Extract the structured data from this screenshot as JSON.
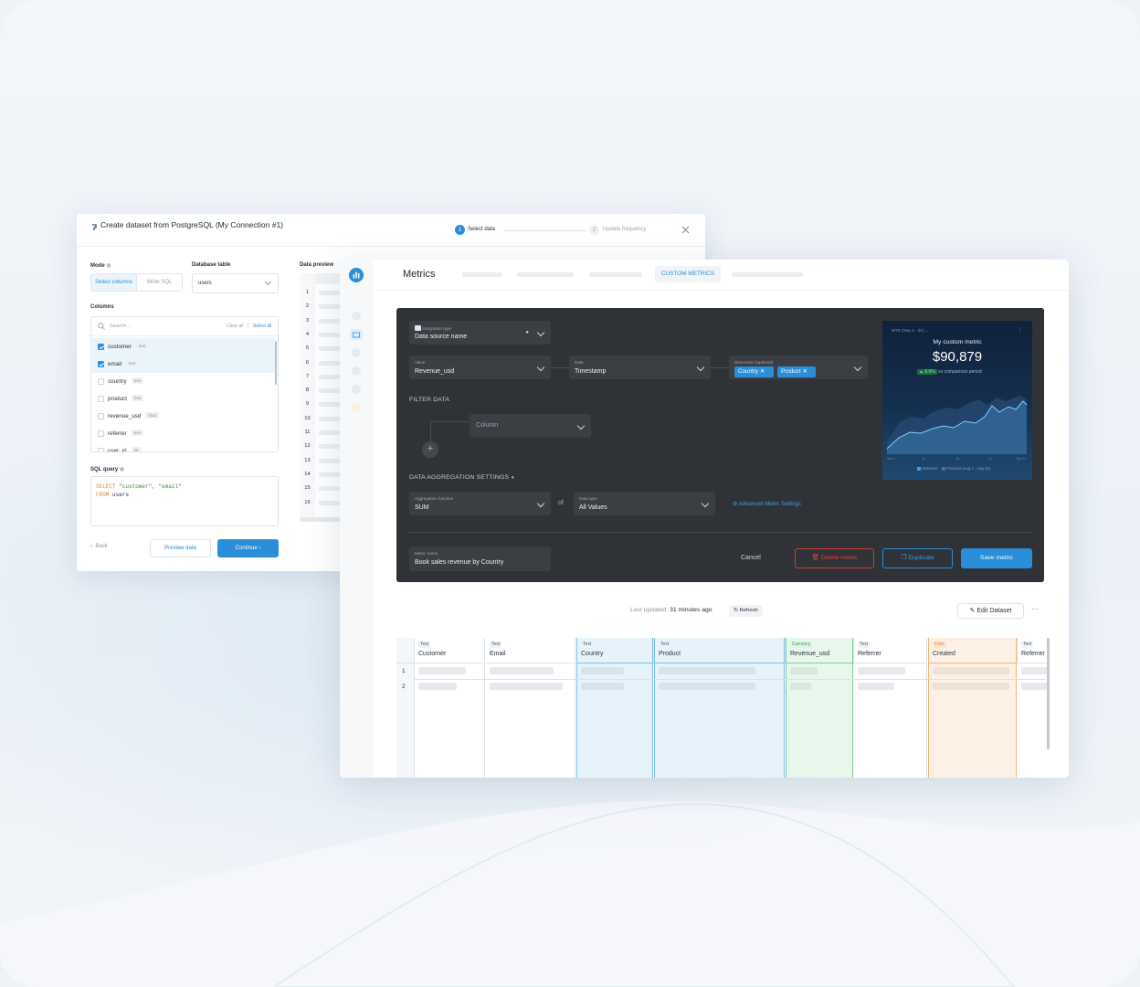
{
  "dataset_dialog": {
    "title": "Create dataset from PostgreSQL (My Connection #1)",
    "steps": [
      {
        "num": "1",
        "label": "Select data"
      },
      {
        "num": "2",
        "label": "Update frequency"
      }
    ],
    "mode": {
      "label": "Mode",
      "options": [
        "Select columns",
        "Write SQL"
      ]
    },
    "database_table": {
      "label": "Database table",
      "value": "users"
    },
    "columns": {
      "label": "Columns",
      "search_placeholder": "Search...",
      "clear_all": "Clear all",
      "select_all": "Select all",
      "items": [
        {
          "name": "customer",
          "type": "text",
          "checked": true
        },
        {
          "name": "email",
          "type": "text",
          "checked": true
        },
        {
          "name": "country",
          "type": "text",
          "checked": false
        },
        {
          "name": "product",
          "type": "text",
          "checked": false
        },
        {
          "name": "revenue_usd",
          "type": "float",
          "checked": false
        },
        {
          "name": "referrer",
          "type": "text",
          "checked": false
        },
        {
          "name": "user_id",
          "type": "int",
          "checked": false
        }
      ]
    },
    "sql_query": {
      "label": "SQL query",
      "line1_kw": "SELECT",
      "line1_rest": "\"customer\", \"email\"",
      "line2_kw": "FROM",
      "line2_rest": "users"
    },
    "data_preview": {
      "label": "Data preview",
      "rows": [
        "1",
        "2",
        "3",
        "4",
        "5",
        "6",
        "7",
        "8",
        "9",
        "10",
        "11",
        "12",
        "13",
        "14",
        "15",
        "16"
      ]
    },
    "back": "Back",
    "preview": "Preview data",
    "continue": "Continue"
  },
  "metrics": {
    "title": "Metrics",
    "active_tab": "CUSTOM METRICS",
    "editor": {
      "integration": {
        "key": "Integration type",
        "value": "Data source name"
      },
      "value": {
        "key": "Value",
        "value": "Revenue_usd"
      },
      "date": {
        "key": "Date",
        "value": "Timestamp"
      },
      "dimension": {
        "key": "Dimension (optional)",
        "chips": [
          "Country",
          "Product"
        ]
      },
      "filter_label": "FILTER DATA",
      "filter_column": "Column",
      "agg_label": "DATA AGGREGATION SETTINGS",
      "agg_function": {
        "key": "Aggregation function",
        "value": "SUM"
      },
      "of": "of",
      "data_type": {
        "key": "Data type",
        "value": "All Values"
      },
      "advanced": "Advanced Metric Settings",
      "metric_name": {
        "key": "Metric name",
        "value": "Book sales revenue by Country"
      },
      "cancel": "Cancel",
      "delete": "Delete metric",
      "duplicate": "Duplicate",
      "save": "Save metric"
    },
    "preview_card": {
      "period": "MTD (Sep 1 - 31) ⌄",
      "title": "My custom metric",
      "value": "$90,879",
      "change": "▲ 8.8%",
      "change_text": "vs comparison period",
      "x_labels": [
        "Sep 1",
        "8",
        "15",
        "22",
        "Sep 31"
      ],
      "legend": [
        "Sessions",
        "Previous (Aug 1 - Aug 31)"
      ]
    },
    "last_updated_label": "Last updated:",
    "last_updated_value": "31 minutes ago",
    "refresh": "Refresh",
    "edit_dataset": "Edit Dataset",
    "more": "···",
    "table": {
      "columns": [
        {
          "type": "Text",
          "name": "Customer"
        },
        {
          "type": "Text",
          "name": "Email"
        },
        {
          "type": "Text",
          "name": "Country"
        },
        {
          "type": "Text",
          "name": "Product"
        },
        {
          "type": "Currency",
          "name": "Revenue_usd"
        },
        {
          "type": "Text",
          "name": "Referrer"
        },
        {
          "type": "Date",
          "name": "Created"
        },
        {
          "type": "Text",
          "name": "Referrer"
        }
      ],
      "rows": [
        "1",
        "2"
      ]
    }
  },
  "colors": {
    "accent": "#2a8ed8",
    "dark_panel": "#2f3236",
    "delete": "#e0453a",
    "currency": "#43b06a",
    "date": "#f0994a"
  }
}
